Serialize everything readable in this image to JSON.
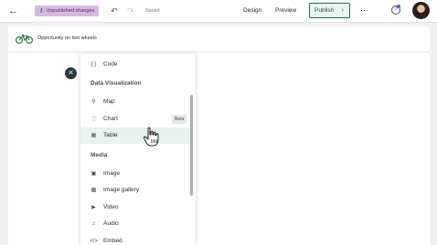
{
  "topbar": {
    "back_icon": "arrow-left-icon",
    "unpublished_label": "Unpublished changes",
    "undo_icon": "undo-icon",
    "redo_icon": "redo-icon",
    "status": "Saved",
    "design_label": "Design",
    "preview_label": "Preview",
    "publish_label": "Publish",
    "more_icon": "more-horizontal-icon",
    "help_icon": "help-icon"
  },
  "document": {
    "title": "Opportunity on two wheels",
    "icon": "bicycle-icon"
  },
  "close_icon": "close-icon",
  "menu": {
    "items": [
      {
        "label": "Code",
        "icon": "code-icon"
      },
      {
        "label": "Map",
        "icon": "map-pin-icon"
      },
      {
        "label": "Chart",
        "icon": "bar-chart-icon",
        "badge": "Beta"
      },
      {
        "label": "Table",
        "icon": "table-icon"
      },
      {
        "label": "Image",
        "icon": "image-icon"
      },
      {
        "label": "Image gallery",
        "icon": "image-gallery-icon"
      },
      {
        "label": "Video",
        "icon": "video-icon"
      },
      {
        "label": "Audio",
        "icon": "audio-icon"
      },
      {
        "label": "Embed",
        "icon": "embed-icon"
      }
    ],
    "sections": {
      "data_visualization": "Data Visualization",
      "media": "Media"
    }
  },
  "colors": {
    "accent": "#1e6b55",
    "unpublished_bg": "#d7b8e0",
    "active_item_bg": "#e6f3ef"
  }
}
